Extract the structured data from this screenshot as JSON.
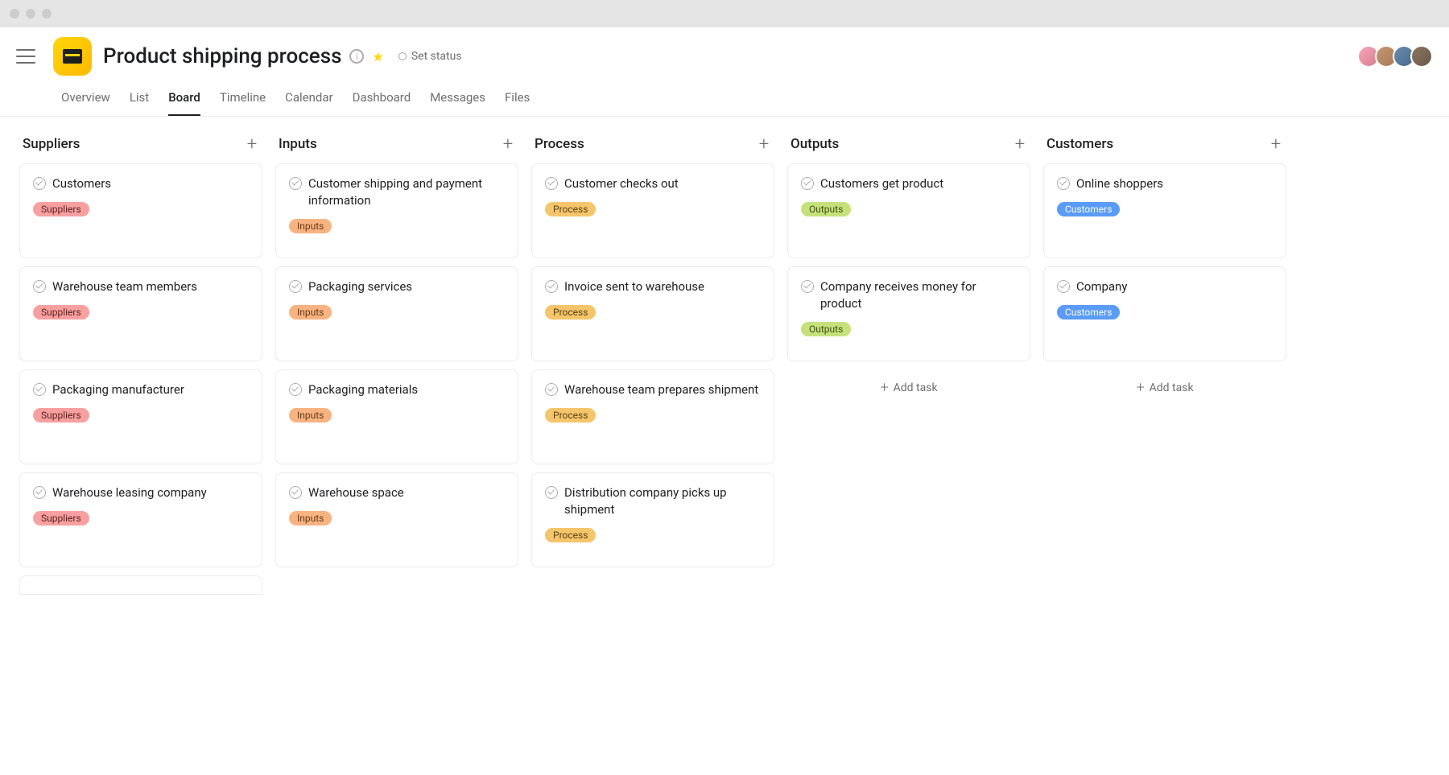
{
  "project_title": "Product shipping process",
  "status_label": "Set status",
  "tabs": [
    "Overview",
    "List",
    "Board",
    "Timeline",
    "Calendar",
    "Dashboard",
    "Messages",
    "Files"
  ],
  "active_tab": "Board",
  "add_task_label": "Add task",
  "columns": [
    {
      "title": "Suppliers",
      "tag_class": "tag-suppliers",
      "cards": [
        {
          "title": "Customers",
          "tag": "Suppliers"
        },
        {
          "title": "Warehouse team members",
          "tag": "Suppliers"
        },
        {
          "title": "Packaging manufacturer",
          "tag": "Suppliers"
        },
        {
          "title": "Warehouse leasing company",
          "tag": "Suppliers"
        }
      ],
      "has_stub": true,
      "show_add_task": false
    },
    {
      "title": "Inputs",
      "tag_class": "tag-inputs",
      "cards": [
        {
          "title": "Customer shipping and payment information",
          "tag": "Inputs"
        },
        {
          "title": "Packaging services",
          "tag": "Inputs"
        },
        {
          "title": "Packaging materials",
          "tag": "Inputs"
        },
        {
          "title": "Warehouse space",
          "tag": "Inputs"
        }
      ],
      "has_stub": false,
      "show_add_task": false
    },
    {
      "title": "Process",
      "tag_class": "tag-process",
      "cards": [
        {
          "title": "Customer checks out",
          "tag": "Process"
        },
        {
          "title": "Invoice sent to warehouse",
          "tag": "Process"
        },
        {
          "title": "Warehouse team prepares shipment",
          "tag": "Process"
        },
        {
          "title": "Distribution company picks up shipment",
          "tag": "Process"
        }
      ],
      "has_stub": false,
      "show_add_task": false
    },
    {
      "title": "Outputs",
      "tag_class": "tag-outputs",
      "cards": [
        {
          "title": "Customers get product",
          "tag": "Outputs"
        },
        {
          "title": "Company receives money for product",
          "tag": "Outputs"
        }
      ],
      "has_stub": false,
      "show_add_task": true
    },
    {
      "title": "Customers",
      "tag_class": "tag-customers",
      "cards": [
        {
          "title": "Online shoppers",
          "tag": "Customers"
        },
        {
          "title": "Company",
          "tag": "Customers"
        }
      ],
      "has_stub": false,
      "show_add_task": true
    }
  ]
}
